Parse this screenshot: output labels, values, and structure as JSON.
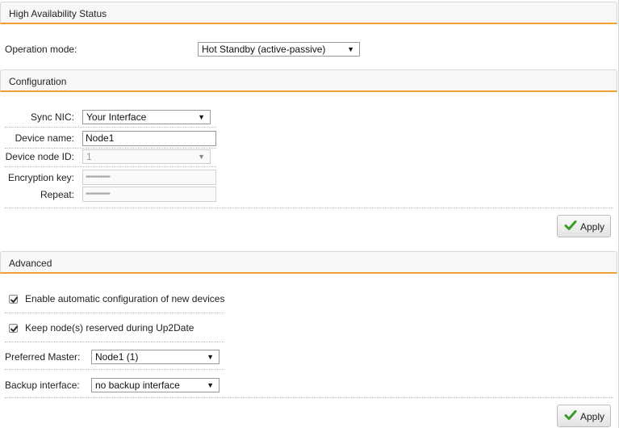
{
  "ha": {
    "header": "High Availability Status",
    "operation_mode_label": "Operation mode:",
    "operation_mode_value": "Hot Standby (active-passive)"
  },
  "config": {
    "header": "Configuration",
    "sync_nic_label": "Sync NIC:",
    "sync_nic_value": "Your Interface",
    "device_name_label": "Device name:",
    "device_name_value": "Node1",
    "device_node_id_label": "Device node ID:",
    "device_node_id_value": "1",
    "encryption_key_label": "Encryption key:",
    "encryption_key_value": "••••••••••••",
    "repeat_label": "Repeat:",
    "repeat_value": "••••••••••••",
    "apply_label": "Apply"
  },
  "advanced": {
    "header": "Advanced",
    "auto_config_label": "Enable automatic configuration of new devices",
    "auto_config_checked": true,
    "keep_reserved_label": "Keep node(s) reserved during Up2Date",
    "keep_reserved_checked": true,
    "preferred_master_label": "Preferred Master:",
    "preferred_master_value": "Node1 (1)",
    "backup_interface_label": "Backup interface:",
    "backup_interface_value": "no backup interface",
    "apply_label": "Apply"
  },
  "colors": {
    "accent": "#f0a030",
    "check_green": "#3a9a2a"
  },
  "icons": {
    "dropdown": "triangle-down-icon",
    "apply": "green-check-icon",
    "checkbox": "checkmark-icon"
  }
}
